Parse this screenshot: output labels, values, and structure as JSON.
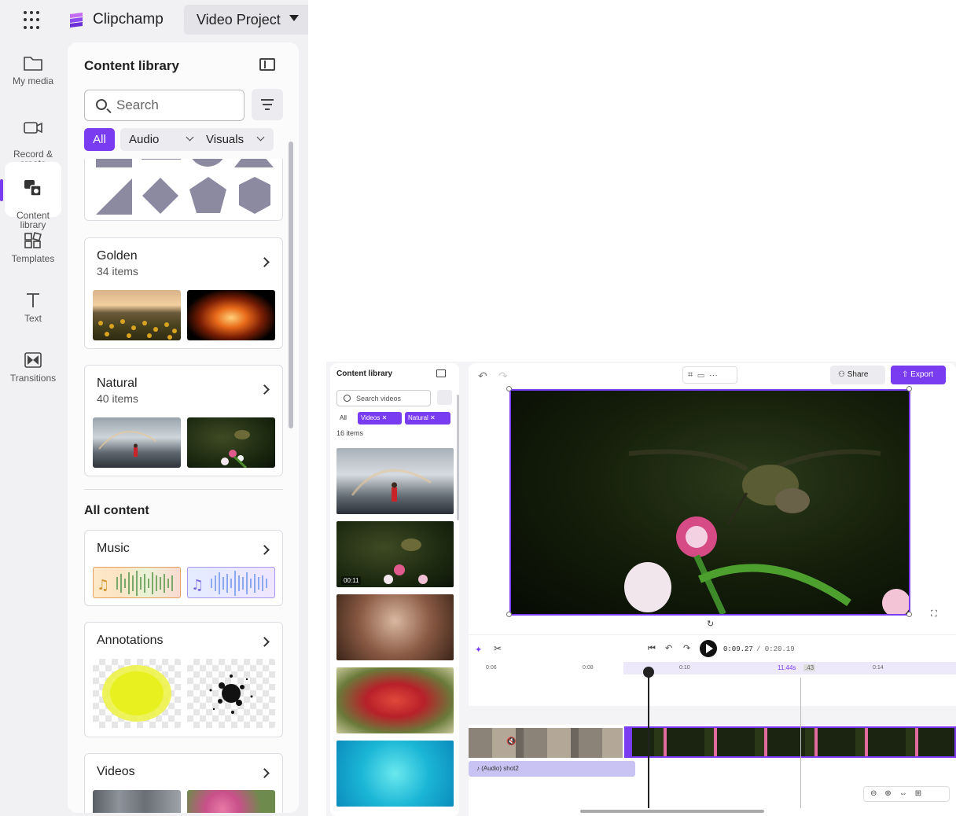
{
  "header": {
    "app_name": "Clipchamp",
    "project_name": "Video Project"
  },
  "rail": [
    {
      "label": "My media",
      "icon": "folder-icon"
    },
    {
      "label": "Record &\ncreate",
      "icon": "camera-icon"
    },
    {
      "label": "Content\nlibrary",
      "icon": "content-library-icon"
    },
    {
      "label": "Templates",
      "icon": "templates-icon"
    },
    {
      "label": "Text",
      "icon": "text-icon"
    },
    {
      "label": "Transitions",
      "icon": "transitions-icon"
    }
  ],
  "library": {
    "title": "Content library",
    "search_placeholder": "Search",
    "filters": {
      "all": "All",
      "audio": "Audio",
      "visuals": "Visuals"
    },
    "collections": [
      {
        "title": "Golden",
        "count": "34 items"
      },
      {
        "title": "Natural",
        "count": "40 items"
      }
    ],
    "all_content_label": "All content",
    "categories": [
      {
        "title": "Music"
      },
      {
        "title": "Annotations"
      },
      {
        "title": "Videos"
      }
    ]
  },
  "embedded": {
    "library_title": "Content library",
    "search_placeholder": "Search videos",
    "chip_all": "All",
    "chip_videos": "Videos",
    "chip_natural": "Natural",
    "count": "16 items",
    "thumb_duration": "00:11",
    "share_label": "Share",
    "export_label": "Export",
    "time_current": "0:09.27",
    "time_total": "/ 0:20.19",
    "ruler": [
      "0:06",
      "0:08",
      "0:10",
      "0:14"
    ],
    "clip_time": "11.44s",
    "clip_extra": ".43",
    "audio_label": "(Audio) shot2"
  },
  "colors": {
    "accent": "#7a3cf0",
    "sidebar_bg": "#f1f1f4",
    "shape_gray": "#8c8aa0"
  }
}
